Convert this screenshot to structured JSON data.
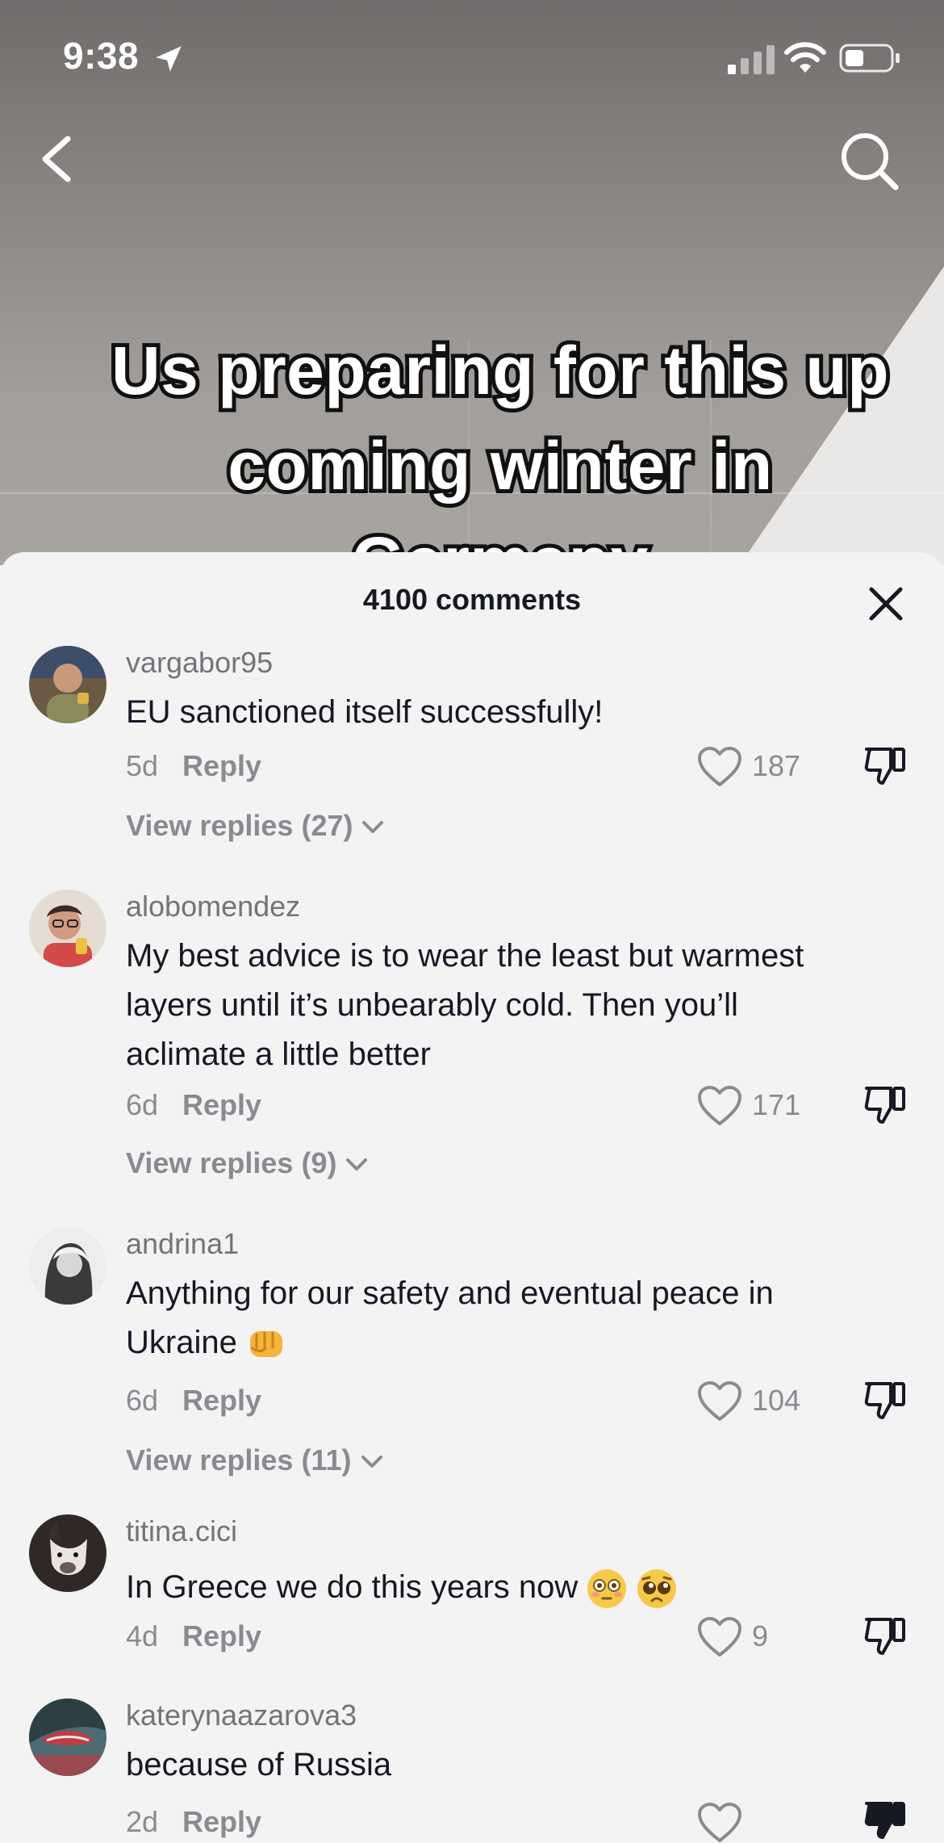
{
  "status_bar": {
    "time": "9:38"
  },
  "video": {
    "caption": "Us preparing for this up coming winter in Germany"
  },
  "comments_sheet": {
    "title": "4100 comments",
    "comments": [
      {
        "username": "vargabor95",
        "text": "EU sanctioned itself successfully!",
        "age": "5d",
        "reply_label": "Reply",
        "likes": "187",
        "view_replies": "View replies (27)",
        "avatar_color": "#6b5a43"
      },
      {
        "username": "alobomendez",
        "text": "My best advice is to wear the least but warmest layers until it’s unbearably cold. Then you’ll aclimate a little better",
        "age": "6d",
        "reply_label": "Reply",
        "likes": "171",
        "view_replies": "View replies (9)",
        "avatar_color": "#c77a5b"
      },
      {
        "username": "andrina1",
        "text": "Anything for our safety and eventual peace in Ukraine",
        "emojis": [
          "oncoming-fist"
        ],
        "age": "6d",
        "reply_label": "Reply",
        "likes": "104",
        "view_replies": "View replies (11)",
        "avatar_color": "#8d8d8d"
      },
      {
        "username": "titina.cici",
        "text": "In Greece we do this years now",
        "emojis": [
          "flushed-face",
          "pleading-face"
        ],
        "age": "4d",
        "reply_label": "Reply",
        "likes": "9",
        "avatar_color": "#3b3130"
      },
      {
        "username": "katerynaazarova3",
        "text": "because of Russia",
        "age": "2d",
        "reply_label": "Reply",
        "avatar_color": "#9a4a4f"
      }
    ]
  },
  "colors": {
    "sheet_background": "#f3f3f3",
    "primary_text": "#161823",
    "secondary_text": "#8a8b91",
    "username_text": "#737479"
  }
}
